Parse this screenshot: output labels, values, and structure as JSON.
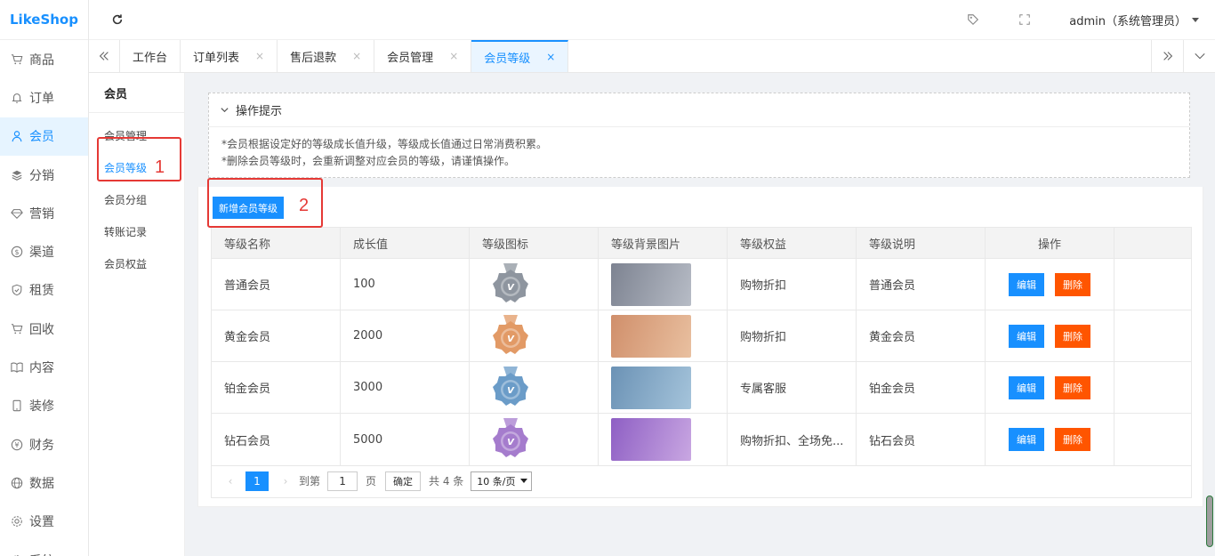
{
  "logo": {
    "text_a": "Like",
    "text_b": "Shop"
  },
  "sidebar": {
    "items": [
      {
        "label": "商品",
        "icon": "cart-icon"
      },
      {
        "label": "订单",
        "icon": "bell-icon"
      },
      {
        "label": "会员",
        "icon": "user-icon"
      },
      {
        "label": "分销",
        "icon": "layers-icon"
      },
      {
        "label": "营销",
        "icon": "diamond-icon"
      },
      {
        "label": "渠道",
        "icon": "dollar-icon"
      },
      {
        "label": "租赁",
        "icon": "shield-icon"
      },
      {
        "label": "回收",
        "icon": "cart-icon"
      },
      {
        "label": "内容",
        "icon": "book-icon"
      },
      {
        "label": "装修",
        "icon": "phone-icon"
      },
      {
        "label": "财务",
        "icon": "yen-icon"
      },
      {
        "label": "数据",
        "icon": "globe-icon"
      },
      {
        "label": "设置",
        "icon": "gear-icon"
      },
      {
        "label": "系统",
        "icon": "gear-icon"
      }
    ],
    "active_index": 2
  },
  "topbar": {
    "user": "admin（系统管理员）"
  },
  "tabs": [
    {
      "label": "工作台",
      "closable": false
    },
    {
      "label": "订单列表",
      "closable": true
    },
    {
      "label": "售后退款",
      "closable": true
    },
    {
      "label": "会员管理",
      "closable": true
    },
    {
      "label": "会员等级",
      "closable": true,
      "active": true
    }
  ],
  "submenu": {
    "title": "会员",
    "items": [
      "会员管理",
      "会员等级",
      "会员分组",
      "转账记录",
      "会员权益"
    ],
    "active_index": 1
  },
  "tips": {
    "title": "操作提示",
    "lines": [
      "*会员根据设定好的等级成长值升级，等级成长值通过日常消费积累。",
      "*删除会员等级时，会重新调整对应会员的等级，请谨慎操作。"
    ]
  },
  "add_button": "新增会员等级",
  "table": {
    "headers": [
      "等级名称",
      "成长值",
      "等级图标",
      "等级背景图片",
      "等级权益",
      "等级说明",
      "操作"
    ],
    "rows": [
      {
        "name": "普通会员",
        "growth": "100",
        "rights": "购物折扣",
        "desc": "普通会员",
        "medal_color": "#8e959f",
        "bg_from": "#7d8391",
        "bg_to": "#b7bcc6"
      },
      {
        "name": "黄金会员",
        "growth": "2000",
        "rights": "购物折扣",
        "desc": "黄金会员",
        "medal_color": "#e29a66",
        "bg_from": "#d08f6b",
        "bg_to": "#e9c0a0"
      },
      {
        "name": "铂金会员",
        "growth": "3000",
        "rights": "专属客服",
        "desc": "铂金会员",
        "medal_color": "#6b9cc8",
        "bg_from": "#6b92b5",
        "bg_to": "#a5c4db"
      },
      {
        "name": "钻石会员",
        "growth": "5000",
        "rights": "购物折扣、全场免...",
        "desc": "钻石会员",
        "medal_color": "#a57ccd",
        "bg_from": "#8e5fc4",
        "bg_to": "#c9a7e2"
      }
    ],
    "edit_label": "编辑",
    "delete_label": "删除"
  },
  "pager": {
    "current": "1",
    "goto_label": "到第",
    "goto_value": "1",
    "page_label": "页",
    "ok_label": "确定",
    "total": "共 4 条",
    "size": "10 条/页"
  },
  "annotations": {
    "box1": "1",
    "box2": "2"
  }
}
